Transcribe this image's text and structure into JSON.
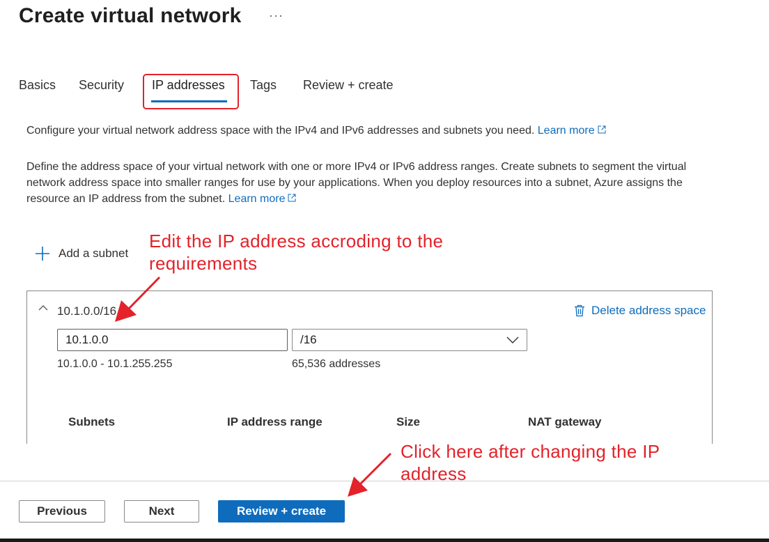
{
  "header": {
    "title": "Create virtual network",
    "more_label": "···"
  },
  "tabs": [
    {
      "label": "Basics",
      "active": false
    },
    {
      "label": "Security",
      "active": false
    },
    {
      "label": "IP addresses",
      "active": true
    },
    {
      "label": "Tags",
      "active": false
    },
    {
      "label": "Review + create",
      "active": false
    }
  ],
  "intro": {
    "text": "Configure your virtual network address space with the IPv4 and IPv6 addresses and subnets you need.",
    "link": "Learn more"
  },
  "description": {
    "text": "Define the address space of your virtual network with one or more IPv4 or IPv6 address ranges. Create subnets to segment the virtual network address space into smaller ranges for use by your applications. When you deploy resources into a subnet, Azure assigns the resource an IP address from the subnet.",
    "link": "Learn more"
  },
  "add_subnet_label": "Add a subnet",
  "address_space": {
    "title": "10.1.0.0/16",
    "delete_label": "Delete address space",
    "ip_value": "10.1.0.0",
    "prefix_value": "/16",
    "range": "10.1.0.0 - 10.1.255.255",
    "count": "65,536 addresses"
  },
  "subnet_table": {
    "columns": [
      "Subnets",
      "IP address range",
      "Size",
      "NAT gateway"
    ]
  },
  "annotations": {
    "edit_ip": "Edit the IP address accroding to the requirements",
    "click_here": "Click here after changing the IP address"
  },
  "footer": {
    "previous_label": "Previous",
    "next_label": "Next",
    "review_label": "Review + create"
  },
  "colors": {
    "accent": "#0f6cbd",
    "annotation": "#e3222a",
    "text": "#323130"
  },
  "icons": {
    "more": "more-icon",
    "external": "external-link-icon",
    "plus": "plus-icon",
    "chevron_up": "chevron-up-icon",
    "trash": "trash-icon",
    "chevron_down": "chevron-down-icon",
    "arrow": "arrow-icon"
  }
}
